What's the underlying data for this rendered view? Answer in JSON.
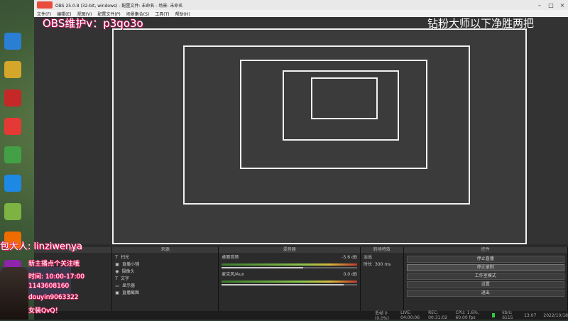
{
  "window": {
    "title": "OBS 25.0.8 (32-bit, windows) - 配置文件: 未命名 - 场景: 未命名",
    "menu": [
      "文件(F)",
      "编辑(E)",
      "视图(V)",
      "配置文件(P)",
      "场景集合(S)",
      "工具(T)",
      "帮助(H)"
    ]
  },
  "overlay": {
    "contact": "OBS维护v：p3qo3o",
    "slogan": "钻粉大师以下净胜两把"
  },
  "docks": {
    "scenes_header": "场景",
    "sources_header": "来源",
    "mixer_header": "混音器",
    "transitions_header": "转场特效",
    "controls_header": "控件",
    "sources": [
      "扫光",
      "直播小铺",
      "摄像头",
      "文字",
      "显示器",
      "直播截图"
    ],
    "mixer": [
      {
        "name": "桌面音频",
        "db": "-5.6 dB",
        "fill": 0.6
      },
      {
        "name": "麦克风/Aux",
        "db": "0.0 dB",
        "fill": 0.9
      }
    ],
    "transition": {
      "type": "淡出",
      "duration_label": "时长",
      "duration": "300 ms"
    },
    "controls": [
      "停止直播",
      "停止录制",
      "工作室模式",
      "设置",
      "退出"
    ]
  },
  "status": {
    "dropped": "丢帧 0 (0.0%)",
    "live": "LIVE: 04:00:06",
    "rec": "REC: 00:31:02",
    "cpu": "CPU: 1.6%, 60.00 fps",
    "bitrate": "kb/s: 6115",
    "time": "13:07",
    "date": "2022/10/18"
  },
  "streamer": {
    "name": "包大人: linziwenya",
    "line1": "新主播点个关注哦",
    "line2": "时间: 10:00-17:00",
    "line3": "1143608160",
    "line4": "douyin9063322",
    "line5": "女装QvQ！"
  },
  "icons": [
    "windows-logo",
    "settings-icon",
    "plus-icon",
    "minus-icon",
    "gear-icon",
    "up-arrow-icon",
    "down-arrow-icon",
    "eye-icon",
    "lock-icon"
  ]
}
